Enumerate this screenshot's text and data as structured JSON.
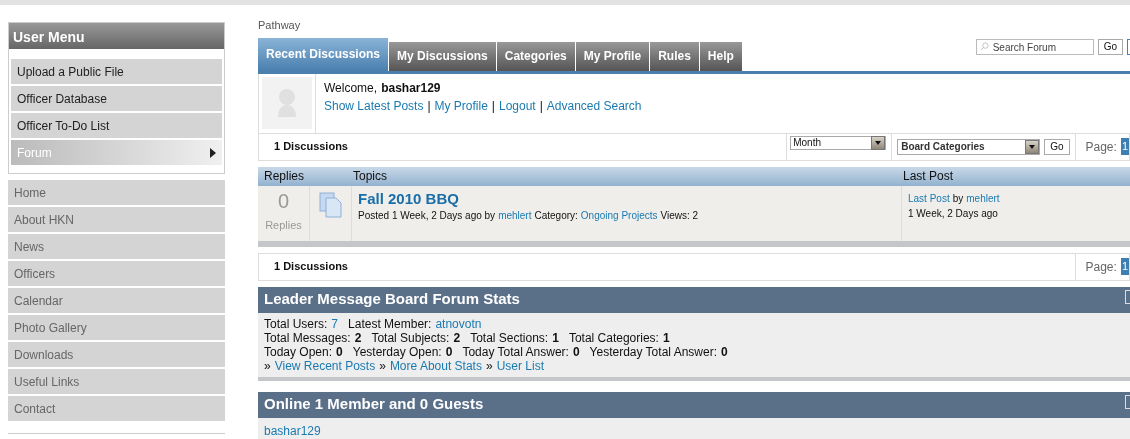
{
  "user_menu": {
    "title": "User Menu",
    "items": [
      {
        "label": "Upload a Public File",
        "selected": false
      },
      {
        "label": "Officer Database",
        "selected": false
      },
      {
        "label": "Officer To-Do List",
        "selected": false
      },
      {
        "label": "Forum",
        "selected": true
      }
    ]
  },
  "main_menu": [
    "Home",
    "About HKN",
    "News",
    "Officers",
    "Calendar",
    "Photo Gallery",
    "Downloads",
    "Useful Links",
    "Contact"
  ],
  "breadcrumb": "Pathway",
  "tabs": [
    {
      "label": "Recent Discussions",
      "selected": true
    },
    {
      "label": "My Discussions",
      "selected": false
    },
    {
      "label": "Categories",
      "selected": false
    },
    {
      "label": "My Profile",
      "selected": false
    },
    {
      "label": "Rules",
      "selected": false
    },
    {
      "label": "Help",
      "selected": false
    }
  ],
  "search": {
    "placeholder": "Search Forum",
    "button": "Go"
  },
  "welcome": {
    "greeting": "Welcome,",
    "user": "bashar129",
    "links": [
      "Show Latest Posts",
      "My Profile",
      "Logout",
      "Advanced Search"
    ],
    "separator": "|"
  },
  "toolbar": {
    "count": "1 Discussions",
    "period": "Month",
    "category": "Board Categories",
    "go": "Go",
    "page_label": "Page:",
    "page": "1"
  },
  "table": {
    "columns": [
      "Replies",
      "Topics",
      "Last Post"
    ],
    "rows": [
      {
        "replies": "0",
        "replies_label": "Replies",
        "title": "Fall 2010 BBQ",
        "posted": "Posted 1 Week, 2 Days ago by",
        "author": "mehlert",
        "category_label": "Category:",
        "category": "Ongoing Projects",
        "views": "Views: 2",
        "last_post_link": "Last Post",
        "last_by": "by",
        "last_author": "mehlert",
        "last_time": "1 Week, 2 Days ago"
      }
    ]
  },
  "footer_bar": {
    "count": "1 Discussions",
    "page_label": "Page:",
    "page": "1"
  },
  "stats": {
    "title": "Leader Message Board Forum Stats",
    "lines": [
      [
        {
          "label": "Total Users:",
          "value": "7",
          "kind": "link"
        },
        {
          "label": "Latest Member:",
          "value": "atnovotn",
          "kind": "link"
        }
      ],
      [
        {
          "label": "Total Messages:",
          "value": "2",
          "kind": "bold"
        },
        {
          "label": "Total Subjects:",
          "value": "2",
          "kind": "bold"
        },
        {
          "label": "Total Sections:",
          "value": "1",
          "kind": "bold"
        },
        {
          "label": "Total Categories:",
          "value": "1",
          "kind": "bold"
        }
      ],
      [
        {
          "label": "Today Open:",
          "value": "0",
          "kind": "bold"
        },
        {
          "label": "Yesterday Open:",
          "value": "0",
          "kind": "bold"
        },
        {
          "label": "Today Total Answer:",
          "value": "0",
          "kind": "bold"
        },
        {
          "label": "Yesterday Total Answer:",
          "value": "0",
          "kind": "bold"
        }
      ]
    ],
    "links": [
      "View Recent Posts",
      "More About Stats",
      "User List"
    ],
    "link_prefix": "»"
  },
  "online": {
    "title": "Online 1 Member and 0 Guests",
    "members": [
      "bashar129"
    ]
  }
}
